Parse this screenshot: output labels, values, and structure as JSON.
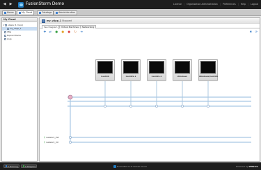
{
  "app": {
    "title": "FusionStorm Demo"
  },
  "top_links": [
    "License",
    "Organization Administration",
    "Preferences",
    "Help",
    "Logout"
  ],
  "main_tabs": [
    {
      "label": "Home"
    },
    {
      "label": "My Cloud"
    },
    {
      "label": "Catalogs"
    },
    {
      "label": "Administration"
    }
  ],
  "sidebar": {
    "title": "My Cloud",
    "items": [
      {
        "label": "vApps (1 more)"
      },
      {
        "label": "my_vApp_1"
      },
      {
        "label": "VMs"
      },
      {
        "label": "Expired Items"
      },
      {
        "label": "Logs"
      }
    ]
  },
  "vapp": {
    "name": "my_vApp_1",
    "status": "Stopped"
  },
  "inner_tabs": [
    "Virtual Machines",
    "Networking"
  ],
  "inner_tab_first": "Veu Diagram",
  "vms": [
    {
      "name": "CentOS"
    },
    {
      "name": "CentOS-1"
    },
    {
      "name": "CentOS-2"
    },
    {
      "name": "Windows"
    },
    {
      "name": "Windows/CentOS"
    }
  ],
  "networks": [
    {
      "name": "network_Ext"
    },
    {
      "name": "network_Int"
    }
  ],
  "status_bar": {
    "running_label": "2 Running",
    "stopped_label": "0 Stopped",
    "center": "FusionStorm IT Virtual Cloud",
    "powered_by": "Powered by",
    "vendor": "VMware"
  },
  "colors": {
    "accent": "#1f7bc1",
    "net_line": "#a8c8e4",
    "vm_line": "#9abcd8"
  },
  "icons": {
    "toolbar": [
      "add-vm-icon",
      "add-network-icon",
      "start-icon",
      "suspend-icon",
      "stop-icon",
      "reset-icon",
      "move-icon"
    ],
    "toolbar_right": [
      "settings-icon",
      "refresh-icon"
    ]
  }
}
